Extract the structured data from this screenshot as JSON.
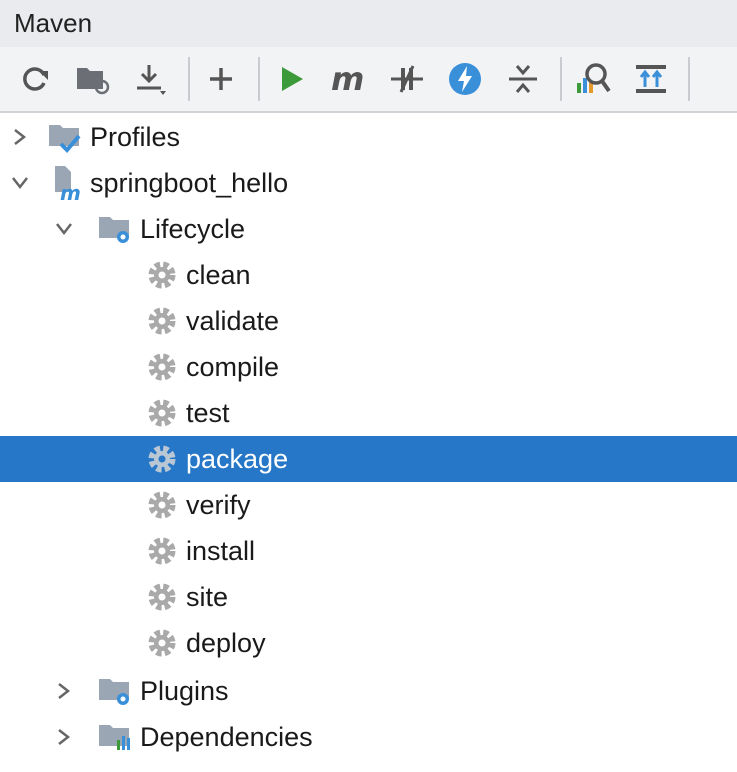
{
  "panel": {
    "title": "Maven"
  },
  "toolbar": {
    "buttons": [
      {
        "name": "reload-icon"
      },
      {
        "name": "generate-sources-icon"
      },
      {
        "name": "download-icon"
      },
      {
        "name": "add-icon"
      },
      {
        "name": "run-icon"
      },
      {
        "name": "execute-goal-icon"
      },
      {
        "name": "toggle-offline-icon"
      },
      {
        "name": "skip-tests-icon"
      },
      {
        "name": "collapse-icon"
      },
      {
        "name": "analyze-dependencies-icon"
      },
      {
        "name": "show-dependencies-icon"
      }
    ]
  },
  "tree": {
    "profiles": "Profiles",
    "project": "springboot_hello",
    "lifecycle": "Lifecycle",
    "goals": [
      "clean",
      "validate",
      "compile",
      "test",
      "package",
      "verify",
      "install",
      "site",
      "deploy"
    ],
    "selected_goal": "package",
    "plugins": "Plugins",
    "dependencies": "Dependencies"
  },
  "colors": {
    "selection": "#2677c7",
    "run_green": "#3d9a3a",
    "icon_blue": "#3a8fd9",
    "gear_gray": "#a9a9a9"
  }
}
